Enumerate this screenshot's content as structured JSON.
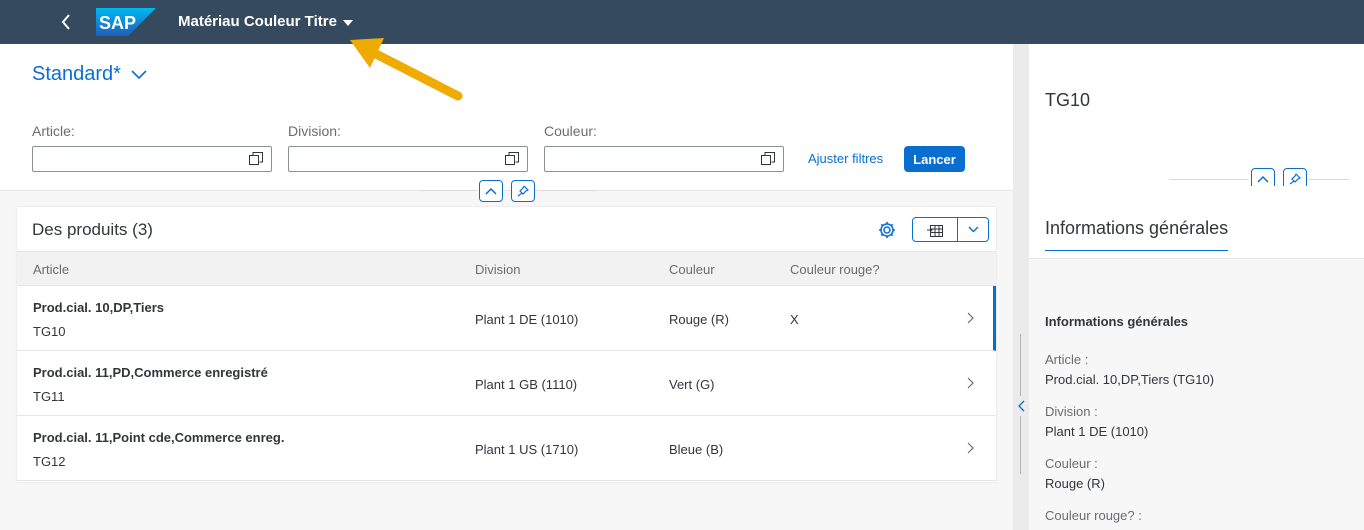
{
  "shell": {
    "logo_text": "SAP",
    "title": "Matériau Couleur Titre"
  },
  "filter": {
    "variant": "Standard*",
    "fields": [
      {
        "label": "Article:",
        "value": ""
      },
      {
        "label": "Division:",
        "value": ""
      },
      {
        "label": "Couleur:",
        "value": ""
      }
    ],
    "adjust_label": "Ajuster filtres",
    "go_label": "Lancer"
  },
  "table": {
    "title": "Des produits (3)",
    "columns": [
      "Article",
      "Division",
      "Couleur",
      "Couleur rouge?"
    ],
    "rows": [
      {
        "name": "Prod.cial. 10,DP,Tiers",
        "id": "TG10",
        "division": "Plant 1 DE (1010)",
        "color": "Rouge (R)",
        "red": "X"
      },
      {
        "name": "Prod.cial. 11,PD,Commerce enregistré",
        "id": "TG11",
        "division": "Plant 1 GB (1110)",
        "color": "Vert (G)",
        "red": ""
      },
      {
        "name": "Prod.cial. 11,Point cde,Commerce enreg.",
        "id": "TG12",
        "division": "Plant 1 US (1710)",
        "color": "Bleue (B)",
        "red": ""
      }
    ]
  },
  "detail": {
    "title": "TG10",
    "anchor_tab": "Informations générales",
    "section_title": "Informations générales",
    "fields": [
      {
        "label": "Article :",
        "value": "Prod.cial. 10,DP,Tiers (TG10)"
      },
      {
        "label": "Division :",
        "value": "Plant 1 DE (1010)"
      },
      {
        "label": "Couleur :",
        "value": "Rouge (R)"
      },
      {
        "label": "Couleur rouge? :",
        "value": ""
      }
    ]
  },
  "colors": {
    "shell_bg": "#354a5f",
    "accent": "#0a6ed1",
    "annotation_arrow": "#f0ab00"
  }
}
